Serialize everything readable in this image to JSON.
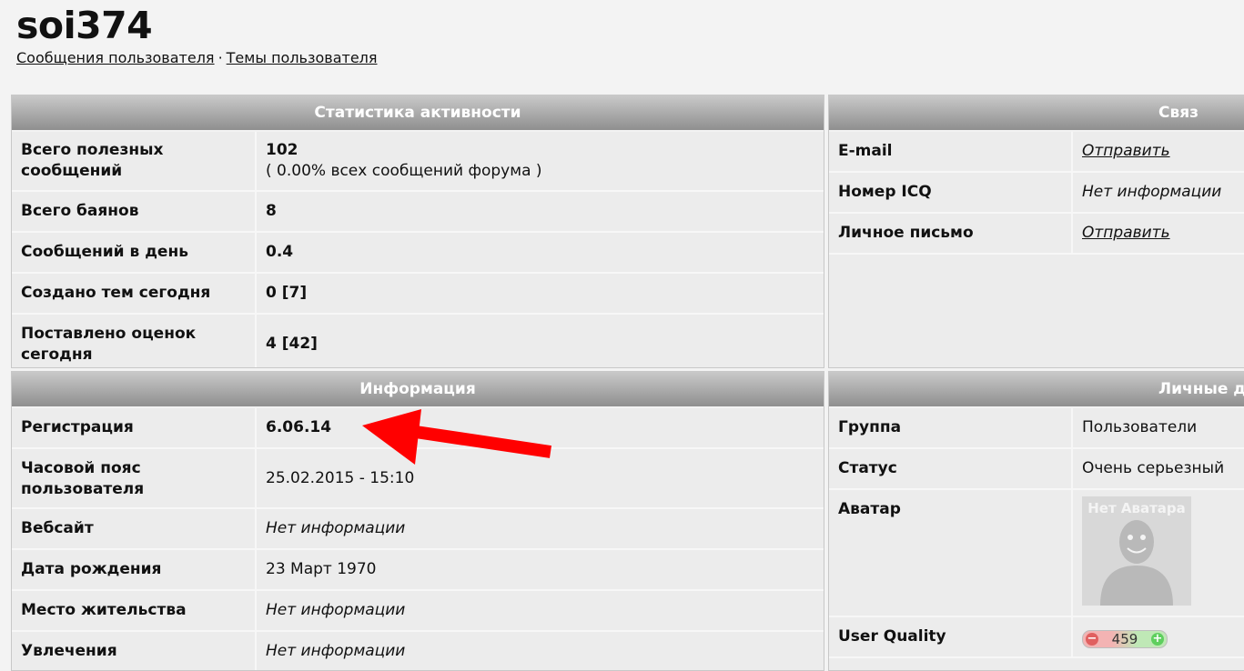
{
  "profile": {
    "username": "soi374",
    "links": [
      "Сообщения пользователя",
      "Темы пользователя"
    ],
    "separator": "·"
  },
  "stats": {
    "header": "Статистика активности",
    "rows": [
      {
        "label": "Всего полезных сообщений",
        "value": "102",
        "sub": "( 0.00% всех сообщений форума )"
      },
      {
        "label": "Всего баянов",
        "value": "8"
      },
      {
        "label": "Сообщений в день",
        "value": "0.4"
      },
      {
        "label": "Создано тем сегодня",
        "value": "0 [7]"
      },
      {
        "label": "Поставлено оценок сегодня",
        "value": "4 [42]"
      }
    ]
  },
  "contact": {
    "header": "Связ",
    "rows": [
      {
        "label": "E-mail",
        "value": "Отправить"
      },
      {
        "label": "Номер ICQ",
        "value": "Нет информации"
      },
      {
        "label": "Личное письмо",
        "value": "Отправить"
      }
    ]
  },
  "info": {
    "header": "Информация",
    "rows": [
      {
        "label": "Регистрация",
        "value": "6.06.14"
      },
      {
        "label": "Часовой пояс пользователя",
        "value": "25.02.2015 - 15:10"
      },
      {
        "label": "Вебсайт",
        "value": "Нет информации"
      },
      {
        "label": "Дата рождения",
        "value": "23 Март 1970"
      },
      {
        "label": "Место жительства",
        "value": "Нет информации"
      },
      {
        "label": "Увлечения",
        "value": "Нет информации"
      }
    ]
  },
  "personal": {
    "header": "Личные д",
    "rows": [
      {
        "label": "Группа",
        "value": "Пользователи"
      },
      {
        "label": "Статус",
        "value": "Очень серьезный"
      },
      {
        "label": "Аватар",
        "avatar_text": "Нет Аватара"
      },
      {
        "label": "User Quality",
        "quality": "459",
        "minus": "−",
        "plus": "+"
      }
    ]
  },
  "colors": {
    "annotation_arrow": "#ff0000",
    "header_top": "#c9c9c9",
    "header_bottom": "#8f8f8f"
  }
}
